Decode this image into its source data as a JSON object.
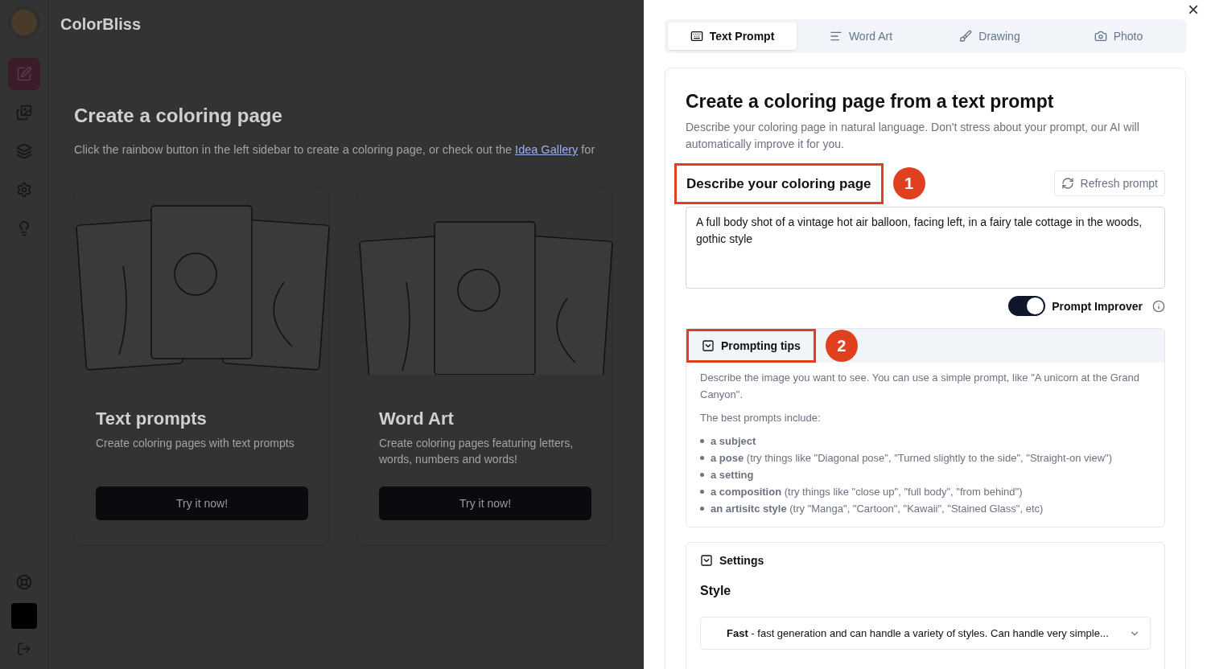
{
  "app": {
    "name": "ColorBliss"
  },
  "sidebar": {
    "items": [
      {
        "selected": true
      },
      {
        "selected": false
      },
      {
        "selected": false
      },
      {
        "selected": false
      },
      {
        "selected": false
      }
    ],
    "bottom_items": [
      {
        "kind": "help"
      },
      {
        "kind": "avatar"
      },
      {
        "kind": "logout"
      }
    ]
  },
  "main": {
    "title": "Create a coloring page",
    "intro": "Click the rainbow button in the left sidebar to create a coloring page, or check out the ",
    "link": "Idea Gallery",
    "intro_end": " for",
    "cards": [
      {
        "title": "Text prompts",
        "description": "Create coloring pages with text prompts",
        "button": "Try it now!"
      },
      {
        "title": "Word Art",
        "description": "Create coloring pages featuring letters, words, numbers and words!",
        "button": "Try it now!"
      }
    ]
  },
  "panel": {
    "close": "×",
    "tabs": [
      {
        "label": "Text Prompt",
        "selected": true
      },
      {
        "label": "Word Art",
        "selected": false
      },
      {
        "label": "Drawing",
        "selected": false
      },
      {
        "label": "Photo",
        "selected": false
      }
    ],
    "title": "Create a coloring page from a text prompt",
    "subtitle": "Describe your coloring page in natural language. Don't stress about your prompt, our AI will automatically improve it for you.",
    "prompt_label": "Describe your coloring page",
    "prompt_marker": "1",
    "refresh_button": "Refresh prompt",
    "prompt_value": "A full body shot of a vintage hot air balloon, facing left, in a fairy tale cottage in the woods, gothic style",
    "improver": {
      "label": "Prompt Improver",
      "on": true
    },
    "tips": {
      "title": "Prompting tips",
      "marker": "2",
      "expanded": true,
      "intro": "Describe the image you want to see. You can use a simple prompt, like \"A unicorn at the Grand Canyon\".",
      "lead": "The best prompts include:",
      "items": [
        "**a subject**",
        "**a pose** (try things like \"Diagonal pose\", \"Turned slightly to the side\", \"Straight-on view\")",
        "**a setting**",
        "**a composition** (try things like \"close up\", \"full body\", \"from behind\")",
        "**an artisitc style** (try \"Manga\", \"Cartoon\", \"Kawaii\", \"Stained Glass\", etc)"
      ]
    },
    "settings": {
      "title": "Settings",
      "style_label": "Style",
      "style_value": "**Fast** - fast generation and can handle a variety of styles. Can handle very simple..."
    }
  }
}
